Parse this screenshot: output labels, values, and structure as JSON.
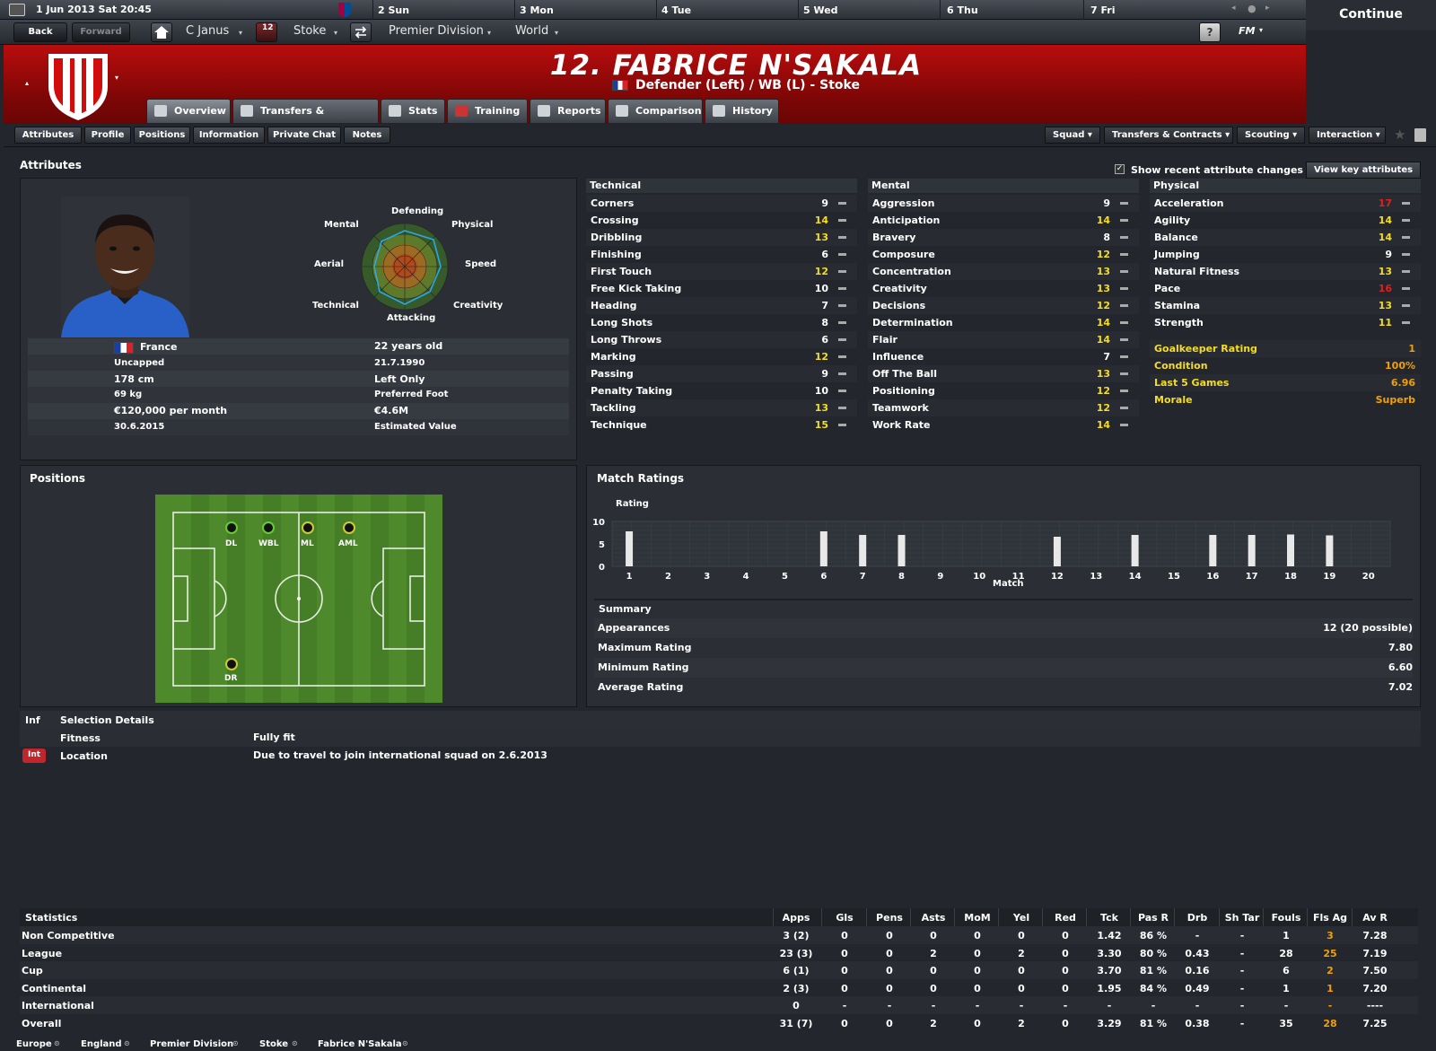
{
  "datebar": {
    "current": "1 Jun 2013  Sat 20:45",
    "days": [
      "2 Sun",
      "3 Mon",
      "4 Tue",
      "5 Wed",
      "6 Thu",
      "7 Fri"
    ]
  },
  "continue_label": "Continue",
  "nav": {
    "back": "Back",
    "forward": "Forward",
    "manager": "C Janus",
    "inbox_count": "12",
    "club": "Stoke",
    "competition": "Premier Division",
    "world": "World",
    "help": "?",
    "fm": "FM"
  },
  "player": {
    "title": "12. FABRICE N'SAKALA",
    "subtitle": "Defender (Left) / WB (L) - Stoke"
  },
  "tabs": [
    "Overview",
    "Transfers & Contracts",
    "Stats",
    "Training",
    "Reports",
    "Comparison",
    "History"
  ],
  "subtabs": [
    "Attributes",
    "Profile",
    "Positions",
    "Information",
    "Private Chat",
    "Notes"
  ],
  "right_buttons": [
    "Squad",
    "Transfers & Contracts",
    "Scouting",
    "Interaction"
  ],
  "attributes_title": "Attributes",
  "show_changes": "Show recent attribute changes",
  "view_key": "View key attributes",
  "spider": {
    "defending": "Defending",
    "physical": "Physical",
    "speed": "Speed",
    "creativity": "Creativity",
    "attacking": "Attacking",
    "technical": "Technical",
    "aerial": "Aerial",
    "mental": "Mental"
  },
  "info": {
    "nation": "France",
    "caps": "Uncapped",
    "height": "178 cm",
    "weight": "69 kg",
    "wage": "€120,000 per month",
    "contract": "30.6.2015",
    "age": "22 years old",
    "dob": "21.7.1990",
    "foot": "Left Only",
    "foot_label": "Preferred Foot",
    "value": "€4.6M",
    "value_label": "Estimated Value"
  },
  "technical": {
    "title": "Technical",
    "rows": [
      [
        "Corners",
        "9",
        "white"
      ],
      [
        "Crossing",
        "14",
        "yellow"
      ],
      [
        "Dribbling",
        "13",
        "yellow"
      ],
      [
        "Finishing",
        "6",
        "white"
      ],
      [
        "First Touch",
        "12",
        "yellow"
      ],
      [
        "Free Kick Taking",
        "10",
        "white"
      ],
      [
        "Heading",
        "7",
        "white"
      ],
      [
        "Long Shots",
        "8",
        "white"
      ],
      [
        "Long Throws",
        "6",
        "white"
      ],
      [
        "Marking",
        "12",
        "yellow"
      ],
      [
        "Passing",
        "9",
        "white"
      ],
      [
        "Penalty Taking",
        "10",
        "white"
      ],
      [
        "Tackling",
        "13",
        "yellow"
      ],
      [
        "Technique",
        "15",
        "yellow"
      ]
    ]
  },
  "mental": {
    "title": "Mental",
    "rows": [
      [
        "Aggression",
        "9",
        "white"
      ],
      [
        "Anticipation",
        "14",
        "yellow"
      ],
      [
        "Bravery",
        "8",
        "white"
      ],
      [
        "Composure",
        "12",
        "yellow"
      ],
      [
        "Concentration",
        "13",
        "yellow"
      ],
      [
        "Creativity",
        "13",
        "yellow"
      ],
      [
        "Decisions",
        "12",
        "yellow"
      ],
      [
        "Determination",
        "14",
        "yellow"
      ],
      [
        "Flair",
        "14",
        "yellow"
      ],
      [
        "Influence",
        "7",
        "white"
      ],
      [
        "Off The Ball",
        "13",
        "yellow"
      ],
      [
        "Positioning",
        "12",
        "yellow"
      ],
      [
        "Teamwork",
        "12",
        "yellow"
      ],
      [
        "Work Rate",
        "14",
        "yellow"
      ]
    ]
  },
  "physical": {
    "title": "Physical",
    "rows": [
      [
        "Acceleration",
        "17",
        "red"
      ],
      [
        "Agility",
        "14",
        "yellow"
      ],
      [
        "Balance",
        "14",
        "yellow"
      ],
      [
        "Jumping",
        "9",
        "white"
      ],
      [
        "Natural Fitness",
        "13",
        "yellow"
      ],
      [
        "Pace",
        "16",
        "red"
      ],
      [
        "Stamina",
        "13",
        "yellow"
      ],
      [
        "Strength",
        "11",
        "yellow"
      ]
    ]
  },
  "extra": [
    [
      "Goalkeeper Rating",
      "1"
    ],
    [
      "Condition",
      "100%"
    ],
    [
      "Last 5 Games",
      "6.96"
    ],
    [
      "Morale",
      "Superb"
    ]
  ],
  "positions": {
    "title": "Positions",
    "labels": [
      "DL",
      "WBL",
      "ML",
      "AML",
      "DR"
    ]
  },
  "match": {
    "title": "Match Ratings",
    "ylabel": "Rating",
    "xlabel": "Match",
    "summary_title": "Summary",
    "summary": [
      [
        "Appearances",
        "12 (20 possible)"
      ],
      [
        "Maximum Rating",
        "7.80"
      ],
      [
        "Minimum Rating",
        "6.60"
      ],
      [
        "Average Rating",
        "7.02"
      ]
    ]
  },
  "chart_data": {
    "type": "bar",
    "title": "Match Ratings",
    "ylabel": "Rating",
    "xlabel": "Match",
    "ylim": [
      0,
      10
    ],
    "yticks": [
      "0",
      "5",
      "10"
    ],
    "categories": [
      "1",
      "2",
      "3",
      "4",
      "5",
      "6",
      "7",
      "8",
      "9",
      "10",
      "11",
      "12",
      "13",
      "14",
      "15",
      "16",
      "17",
      "18",
      "19",
      "20"
    ],
    "values": [
      7.8,
      null,
      null,
      null,
      null,
      7.8,
      7.0,
      7.0,
      null,
      null,
      null,
      6.6,
      null,
      7.0,
      null,
      7.0,
      7.0,
      7.1,
      6.9,
      null
    ]
  },
  "selection": {
    "inf": "Inf",
    "title": "Selection Details",
    "fitness_label": "Fitness",
    "fitness": "Fully fit",
    "badge": "Int",
    "location_label": "Location",
    "location": "Due to travel to join international squad on 2.6.2013"
  },
  "stats": {
    "title": "Statistics",
    "cols": [
      "Apps",
      "Gls",
      "Pens",
      "Asts",
      "MoM",
      "Yel",
      "Red",
      "Tck",
      "Pas R",
      "Drb",
      "Sh Tar",
      "Fouls",
      "Fls Ag",
      "Av R"
    ],
    "rows": [
      [
        "Non Competitive",
        "3 (2)",
        "0",
        "0",
        "0",
        "0",
        "0",
        "0",
        "1.42",
        "86 %",
        "-",
        "-",
        "1",
        "3",
        "7.28"
      ],
      [
        "League",
        "23 (3)",
        "0",
        "0",
        "2",
        "0",
        "2",
        "0",
        "3.30",
        "80 %",
        "0.43",
        "-",
        "28",
        "25",
        "7.19"
      ],
      [
        "Cup",
        "6 (1)",
        "0",
        "0",
        "0",
        "0",
        "0",
        "0",
        "3.70",
        "81 %",
        "0.16",
        "-",
        "6",
        "2",
        "7.50"
      ],
      [
        "Continental",
        "2 (3)",
        "0",
        "0",
        "0",
        "0",
        "0",
        "0",
        "1.95",
        "84 %",
        "0.49",
        "-",
        "1",
        "1",
        "7.20"
      ],
      [
        "International",
        "0",
        "-",
        "-",
        "-",
        "-",
        "-",
        "-",
        "-",
        "-",
        "-",
        "-",
        "-",
        "-",
        "----"
      ],
      [
        "Overall",
        "31 (7)",
        "0",
        "0",
        "2",
        "0",
        "2",
        "0",
        "3.29",
        "81 %",
        "0.38",
        "-",
        "35",
        "28",
        "7.25"
      ]
    ]
  },
  "footer": [
    "Europe",
    "England",
    "Premier Division",
    "Stoke",
    "Fabrice N'Sakala"
  ],
  "colors": {
    "header_red": "#a80a0a",
    "yellow": "#f4dd24",
    "red": "#e02020",
    "orange": "#f2a000",
    "pitch": "#4e8a2c"
  }
}
